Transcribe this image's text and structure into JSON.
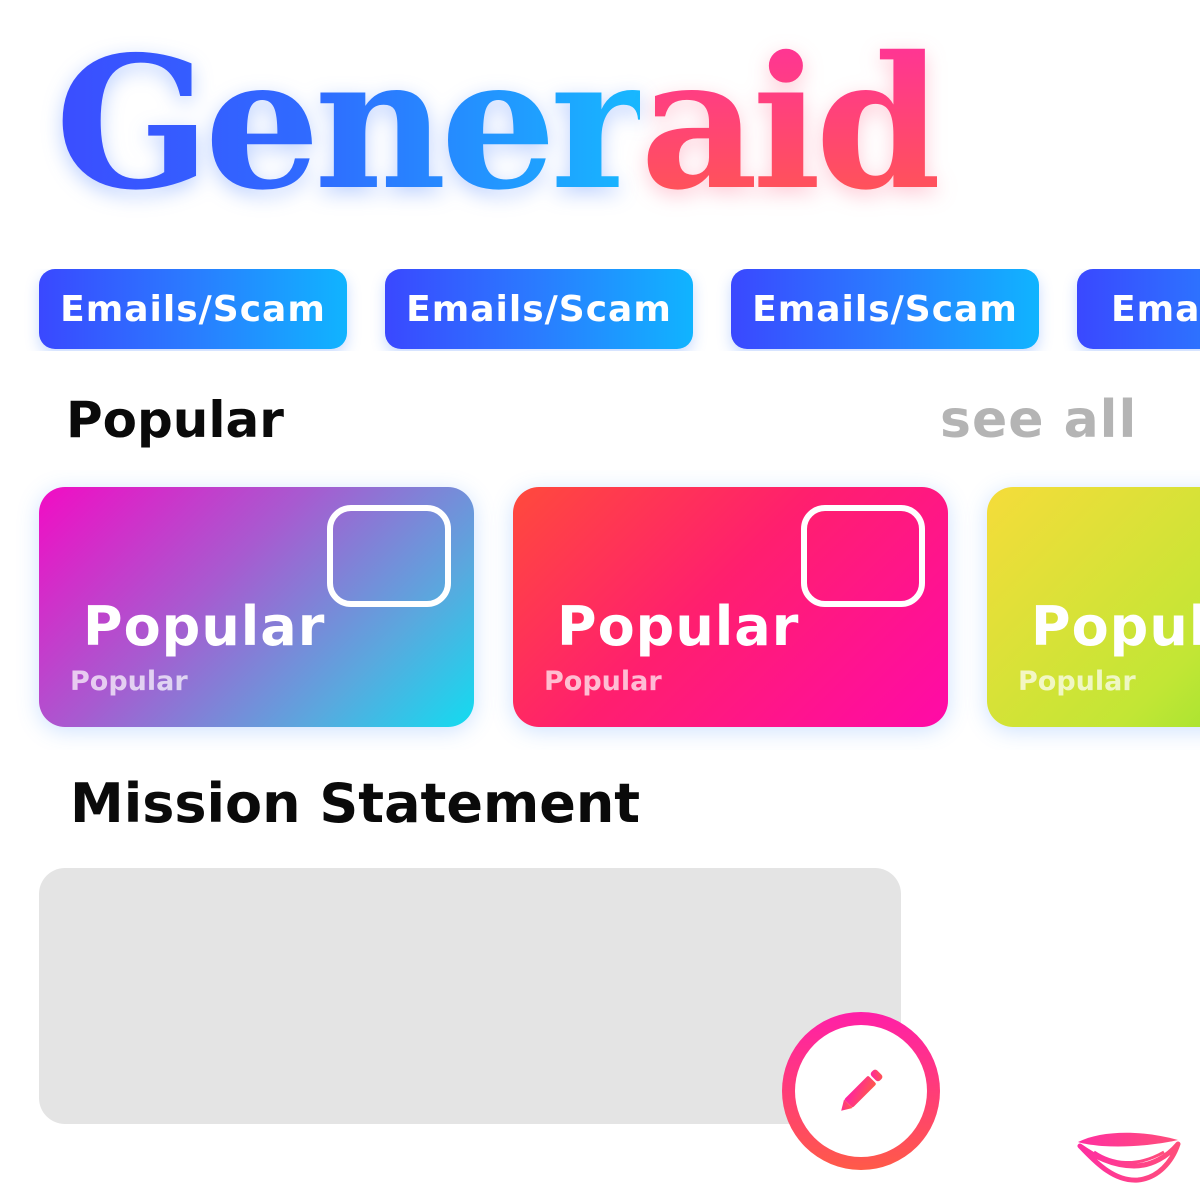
{
  "logo": {
    "part1": "Gener",
    "part2": "aid"
  },
  "categories": [
    {
      "label": "Emails/Scam"
    },
    {
      "label": "Emails/Scam"
    },
    {
      "label": "Emails/Scam"
    },
    {
      "label": "Emai"
    }
  ],
  "popular": {
    "title": "Popular",
    "see_all": "see all",
    "cards": [
      {
        "title": "Popular",
        "subtitle": "Popular"
      },
      {
        "title": "Popular",
        "subtitle": "Popular"
      },
      {
        "title": "Popula",
        "subtitle": "Popular"
      }
    ]
  },
  "mission": {
    "title": "Mission Statement"
  },
  "icons": {
    "fab": "pencil-icon",
    "card": "square-outline-icon",
    "brand": "lips-logo-icon"
  },
  "colors": {
    "chip_start": "#3a48ff",
    "chip_end": "#10b4ff",
    "logo_blue": "#2f6cff",
    "logo_pink": "#ff2fa0",
    "mission_bg": "#e4e4e4",
    "see_all": "#b4b4b4"
  }
}
